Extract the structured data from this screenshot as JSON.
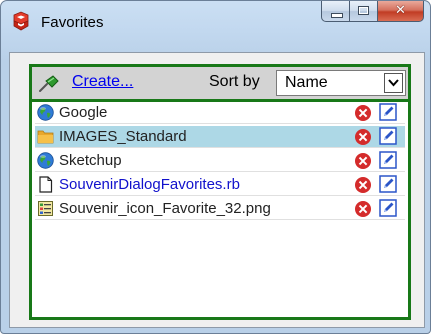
{
  "window": {
    "title": "Favorites",
    "caption": {
      "minimize_icon": "minimize-icon",
      "maximize_icon": "maximize-icon",
      "close_icon": "close-icon"
    }
  },
  "toolbar": {
    "create_label": "Create...",
    "sort_label": "Sort by",
    "sort_value": "Name"
  },
  "items": [
    {
      "label": "Google",
      "icon": "globe-icon",
      "style": "normal"
    },
    {
      "label": "IMAGES_Standard",
      "icon": "folder-icon",
      "style": "normal",
      "selected": true
    },
    {
      "label": "Sketchup",
      "icon": "globe-icon",
      "style": "normal"
    },
    {
      "label": "SouvenirDialogFavorites.rb",
      "icon": "document-icon",
      "style": "link"
    },
    {
      "label": "Souvenir_icon_Favorite_32.png",
      "icon": "image-file-icon",
      "style": "normal"
    }
  ],
  "colors": {
    "frame_green": "#187818",
    "selected_row": "#add8e6",
    "link_blue": "#0000ee",
    "delete_red": "#d42b2b"
  }
}
